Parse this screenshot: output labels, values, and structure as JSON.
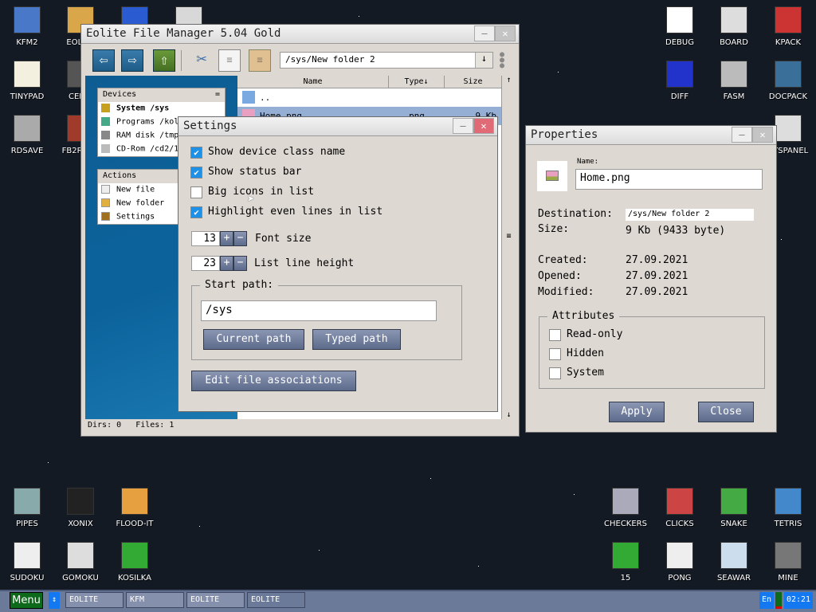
{
  "desktop": {
    "icons_left": [
      {
        "label": "KFM2",
        "color": "#4a78c8"
      },
      {
        "label": "EOLITE",
        "color": "#d9a64a"
      },
      {
        "label": "",
        "color": "#2a5bd0"
      },
      {
        "label": "",
        "color": "#d8d8d8"
      },
      {
        "label": "TINYPAD",
        "color": "#f4f0e0"
      },
      {
        "label": "CEDIT",
        "color": "#555"
      },
      {
        "label": "RDSAVE",
        "color": "#aaa"
      },
      {
        "label": "FB2READ",
        "color": "#a03a2a"
      }
    ],
    "icons_right": [
      {
        "label": "DEBUG",
        "color": "#fff"
      },
      {
        "label": "BOARD",
        "color": "#ddd"
      },
      {
        "label": "KPACK",
        "color": "#c33"
      },
      {
        "label": "DIFF",
        "color": "#2233cc"
      },
      {
        "label": "FASM",
        "color": "#bbb"
      },
      {
        "label": "DOCPACK",
        "color": "#3a6f9a"
      },
      {
        "label": "SYSPANEL",
        "color": "#ddd"
      }
    ],
    "icons_bottom_left": [
      {
        "label": "PIPES",
        "color": "#8aa"
      },
      {
        "label": "XONIX",
        "color": "#222"
      },
      {
        "label": "FLOOD-IT",
        "color": "#e6a040"
      },
      {
        "label": "SUDOKU",
        "color": "#eee"
      },
      {
        "label": "GOMOKU",
        "color": "#ddd"
      },
      {
        "label": "KOSILKA",
        "color": "#3a3"
      }
    ],
    "icons_bottom_right": [
      {
        "label": "CHECKERS",
        "color": "#aab"
      },
      {
        "label": "CLICKS",
        "color": "#c44"
      },
      {
        "label": "SNAKE",
        "color": "#4a4"
      },
      {
        "label": "TETRIS",
        "color": "#48c"
      },
      {
        "label": "15",
        "color": "#3a3"
      },
      {
        "label": "PONG",
        "color": "#eee"
      },
      {
        "label": "SEAWAR",
        "color": "#cde"
      },
      {
        "label": "MINE",
        "color": "#777"
      }
    ]
  },
  "eolite": {
    "title": "Eolite File Manager 5.04 Gold",
    "path": "/sys/New folder 2",
    "devices_header": "Devices",
    "devices_menu": "=",
    "devices": [
      "System /sys",
      "Programs /kolibrios",
      "RAM disk /tmp0/1",
      "CD-Rom /cd2/1"
    ],
    "actions_header": "Actions",
    "actions": [
      "New file",
      "New folder",
      "Settings"
    ],
    "columns": {
      "name": "Name",
      "type": "Type↓",
      "size": "Size"
    },
    "files": [
      {
        "name": "..",
        "type": "",
        "size": ""
      },
      {
        "name": "Home.png",
        "type": "png",
        "size": "9 Kb"
      }
    ],
    "status": "Dirs: 0   Files: 1"
  },
  "settings": {
    "title": "Settings",
    "options": [
      {
        "label": "Show device class name",
        "checked": true
      },
      {
        "label": "Show status bar",
        "checked": true
      },
      {
        "label": "Big icons in list",
        "checked": false
      },
      {
        "label": "Highlight even lines in list",
        "checked": true
      }
    ],
    "font_size": "13",
    "font_size_label": "Font size",
    "line_height": "23",
    "line_height_label": "List line height",
    "start_path_label": "Start path:",
    "start_path": "/sys",
    "current_path": "Current path",
    "typed_path": "Typed path",
    "edit_assoc": "Edit file associations"
  },
  "properties": {
    "title": "Properties",
    "name_label": "Name:",
    "name": "Home.png",
    "destination_label": "Destination:",
    "destination": "/sys/New folder 2",
    "size_label": "Size:",
    "size": "9 Kb (9433 byte)",
    "created_label": "Created:",
    "created": "27.09.2021",
    "opened_label": "Opened:",
    "opened": "27.09.2021",
    "modified_label": "Modified:",
    "modified": "27.09.2021",
    "attributes_label": "Attributes",
    "attributes": [
      {
        "label": "Read-only",
        "checked": false
      },
      {
        "label": "Hidden",
        "checked": false
      },
      {
        "label": "System",
        "checked": false
      }
    ],
    "apply": "Apply",
    "close": "Close"
  },
  "taskbar": {
    "menu": "Menu",
    "tasks": [
      "EOLITE",
      "KFM",
      "EOLITE",
      "EOLITE"
    ],
    "lang": "En",
    "clock": "02:21"
  }
}
